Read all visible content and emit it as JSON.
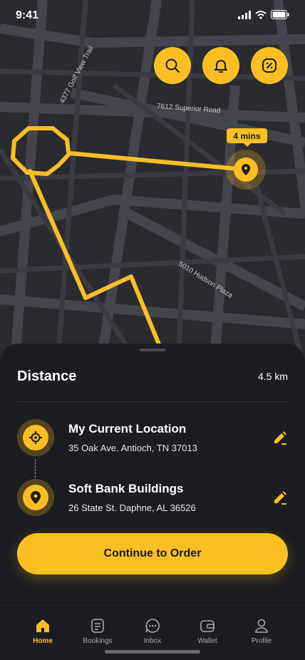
{
  "status": {
    "time": "9:41"
  },
  "map": {
    "streets": [
      "4377 Golf View Trail",
      "7612 Superior Road",
      "5010 Hudson Plaza"
    ],
    "eta": "4 mins"
  },
  "top_actions": [
    {
      "icon": "search-icon"
    },
    {
      "icon": "bell-icon"
    },
    {
      "icon": "discount-icon"
    }
  ],
  "sheet": {
    "title": "Distance",
    "distance": "4.5 km",
    "origin": {
      "name": "My Current Location",
      "address": "35 Oak Ave. Antioch, TN 37013"
    },
    "destination": {
      "name": "Soft Bank Buildings",
      "address": "26 State St. Daphne, AL 36526"
    },
    "cta": "Continue to Order"
  },
  "nav": {
    "items": [
      {
        "label": "Home",
        "icon": "home-icon",
        "active": true
      },
      {
        "label": "Bookings",
        "icon": "document-icon",
        "active": false
      },
      {
        "label": "Inbox",
        "icon": "chat-icon",
        "active": false
      },
      {
        "label": "Wallet",
        "icon": "wallet-icon",
        "active": false
      },
      {
        "label": "Profile",
        "icon": "user-icon",
        "active": false
      }
    ]
  },
  "colors": {
    "accent": "#fbbf24",
    "background": "#1c1d22",
    "map": "#2a2b31",
    "roads": "#44454c"
  }
}
